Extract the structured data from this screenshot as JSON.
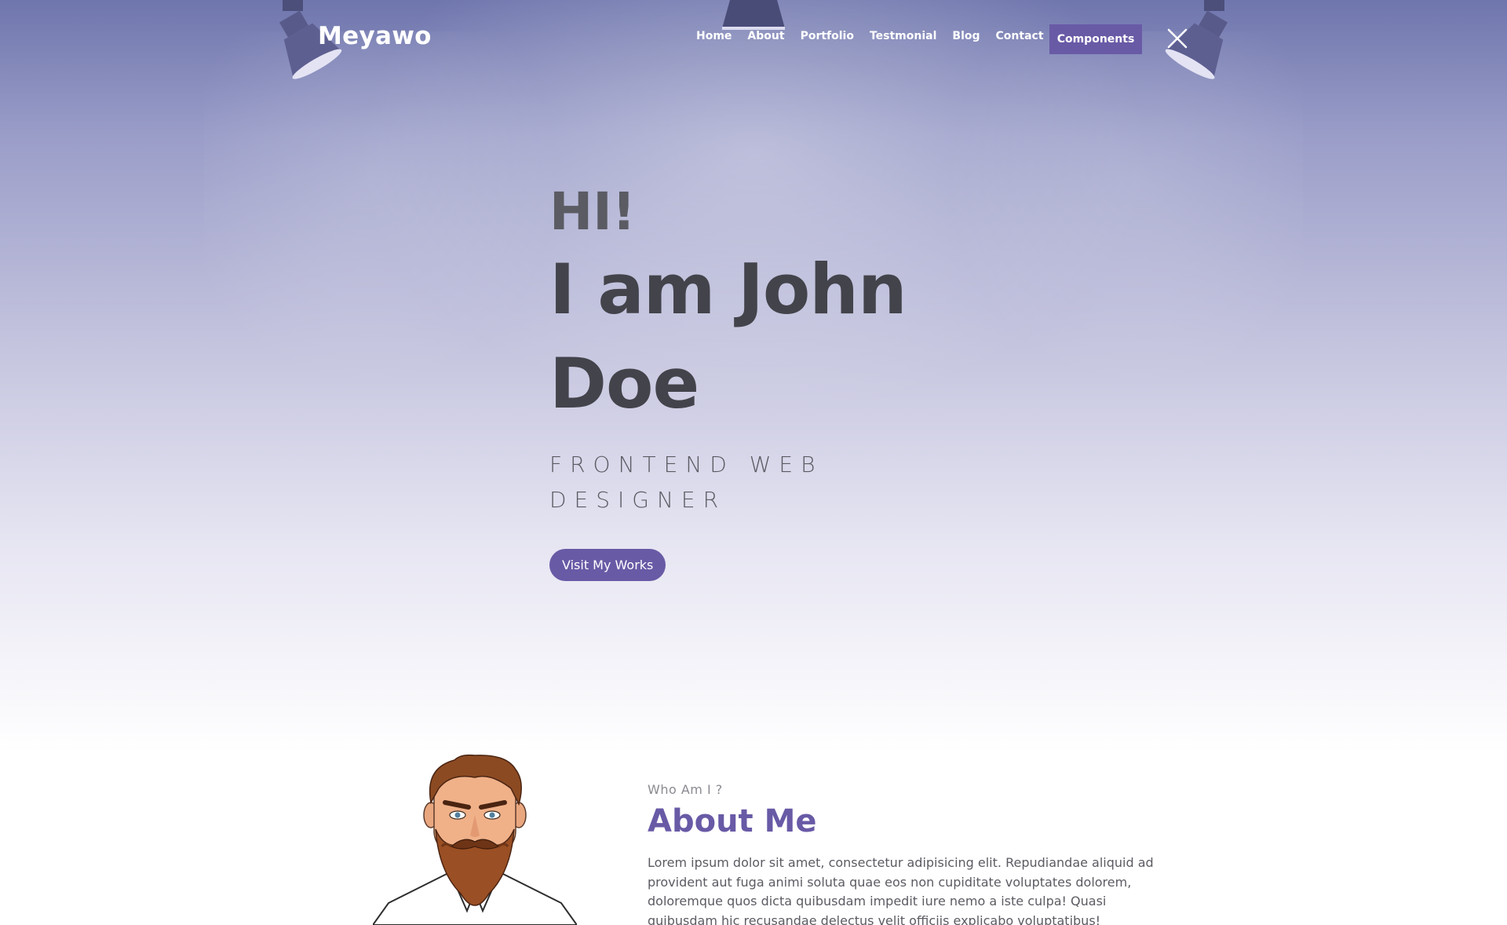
{
  "brand": {
    "name": "Meyawo"
  },
  "nav": {
    "links": [
      "Home",
      "About",
      "Portfolio",
      "Testmonial",
      "Blog",
      "Contact"
    ],
    "cta_label": "Components",
    "close_icon": "close-icon"
  },
  "hero": {
    "greeting": "HI!",
    "title": "I am John Doe",
    "subtitle": "FRONTEND WEB DESIGNER",
    "button_label": "Visit My Works"
  },
  "about": {
    "eyebrow": "Who Am I ?",
    "title": "About Me",
    "paragraph": "Lorem ipsum dolor sit amet, consectetur adipisicing elit. Repudiandae aliquid ad provident aut fuga animi soluta quae eos non cupiditate voluptates dolorem, doloremque quos dicta quibusdam impedit iure nemo a iste culpa! Quasi quibusdam hic recusandae delectus velit officiis explicabo voluptatibus!"
  },
  "colors": {
    "accent": "#695aa6",
    "hero_top": "#6f76ad",
    "text_dark": "#43434b"
  }
}
